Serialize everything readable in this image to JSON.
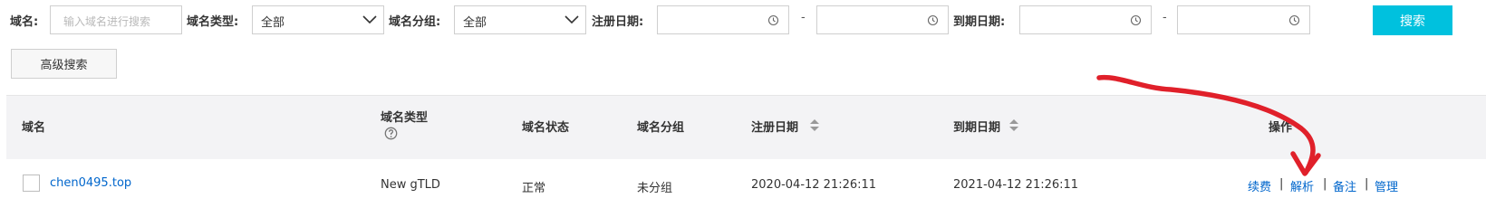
{
  "filters": {
    "domain_label": "域名:",
    "domain_placeholder": "输入域名进行搜索",
    "type_label": "域名类型:",
    "type_value": "全部",
    "group_label": "域名分组:",
    "group_value": "全部",
    "reg_date_label": "注册日期:",
    "exp_date_label": "到期日期:",
    "range_sep": "-",
    "search_button": "搜索",
    "advanced_button": "高级搜索"
  },
  "table": {
    "headers": {
      "domain": "域名",
      "type": "域名类型",
      "status": "域名状态",
      "group": "域名分组",
      "reg_date": "注册日期",
      "exp_date": "到期日期",
      "actions": "操作"
    },
    "rows": [
      {
        "domain": "chen0495.top",
        "type": "New gTLD",
        "status": "正常",
        "group": "未分组",
        "reg_date": "2020-04-12 21:26:11",
        "exp_date": "2021-04-12 21:26:11",
        "actions": [
          "续费",
          "解析",
          "备注",
          "管理"
        ],
        "action_sep": "|"
      }
    ]
  },
  "icons": {
    "dropdown": "chevron-down-icon",
    "date": "clock-icon",
    "sort": "sort-icon",
    "help": "help-icon"
  },
  "colors": {
    "accent": "#00c1de",
    "link": "#0066cc",
    "annotation": "#e0202a",
    "header_bg": "#f3f3f5"
  }
}
